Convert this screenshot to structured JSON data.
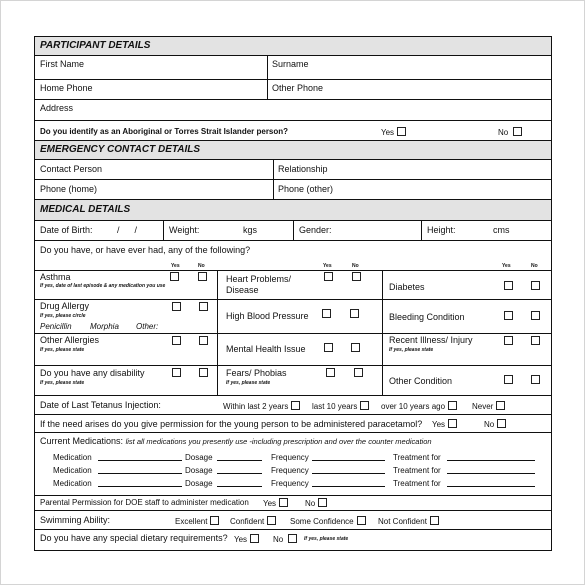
{
  "participant": {
    "header": "PARTICIPANT DETAILS",
    "first_name_label": "First Name",
    "surname_label": "Surname",
    "home_phone_label": "Home Phone",
    "other_phone_label": "Other Phone",
    "address_label": "Address",
    "aboriginal_question": "Do you identify as an Aboriginal or Torres Strait Islander person?",
    "yes_label": "Yes",
    "no_label": "No"
  },
  "emergency": {
    "header": "EMERGENCY CONTACT  DETAILS",
    "contact_person_label": "Contact Person",
    "relationship_label": "Relationship",
    "phone_home_label": "Phone (home)",
    "phone_other_label": "Phone (other)"
  },
  "medical": {
    "header": "MEDICAL DETAILS",
    "dob_label": "Date of Birth:",
    "dob_sep": "/      /",
    "weight_label": "Weight:",
    "weight_unit": "kgs",
    "gender_label": "Gender:",
    "height_label": "Height:",
    "height_unit": "cms",
    "conditions_question": "Do you have, or have ever had, any of the following?",
    "yes_col": "Yes",
    "no_col": "No",
    "conditions": {
      "asthma": {
        "label": "Asthma",
        "note": "If yes, date of last episode &  any  medication you use"
      },
      "drug_allergy": {
        "label": "Drug Allergy",
        "note": "If yes, please circle",
        "options": [
          "Penicillin",
          "Morphia",
          "Other:"
        ]
      },
      "other_allergies": {
        "label": "Other Allergies",
        "note": "If yes, please state"
      },
      "disability": {
        "label": "Do you have any disability",
        "note": "If yes, please state"
      },
      "heart": {
        "label": "Heart Problems/ Disease"
      },
      "blood_pressure": {
        "label": "High Blood Pressure"
      },
      "mental_health": {
        "label": "Mental Health Issue"
      },
      "fears": {
        "label": "Fears/ Phobias",
        "note": "If yes, please state"
      },
      "diabetes": {
        "label": "Diabetes"
      },
      "bleeding": {
        "label": "Bleeding Condition"
      },
      "recent_illness": {
        "label": "Recent Illness/ Injury",
        "note": "If yes, please state"
      },
      "other_condition": {
        "label": "Other Condition"
      }
    },
    "tetanus": {
      "label": "Date of Last Tetanus Injection:",
      "options": [
        "Within last 2 years",
        "last 10 years",
        "over 10 years ago",
        "Never"
      ]
    },
    "paracetamol": {
      "question": "If the need arises do you give permission for the young person to be administered paracetamol?",
      "yes": "Yes",
      "no": "No"
    },
    "medications": {
      "label": "Current Medications:",
      "note": "list all medications you presently use -including prescription and over the counter medication",
      "medication_label": "Medication",
      "dosage_label": "Dosage",
      "frequency_label": "Frequency",
      "treatment_label": "Treatment for",
      "rows": 3
    },
    "parental_permission": {
      "label": "Parental Permission for DOE staff to administer medication",
      "yes": "Yes",
      "no": "No"
    },
    "swimming": {
      "label": "Swimming Ability:",
      "options": [
        "Excellent",
        "Confident",
        "Some Confidence",
        "Not Confident"
      ]
    },
    "dietary": {
      "question": "Do you have any special dietary requirements?",
      "yes": "Yes",
      "no": "No",
      "note": "If yes, please state"
    }
  }
}
